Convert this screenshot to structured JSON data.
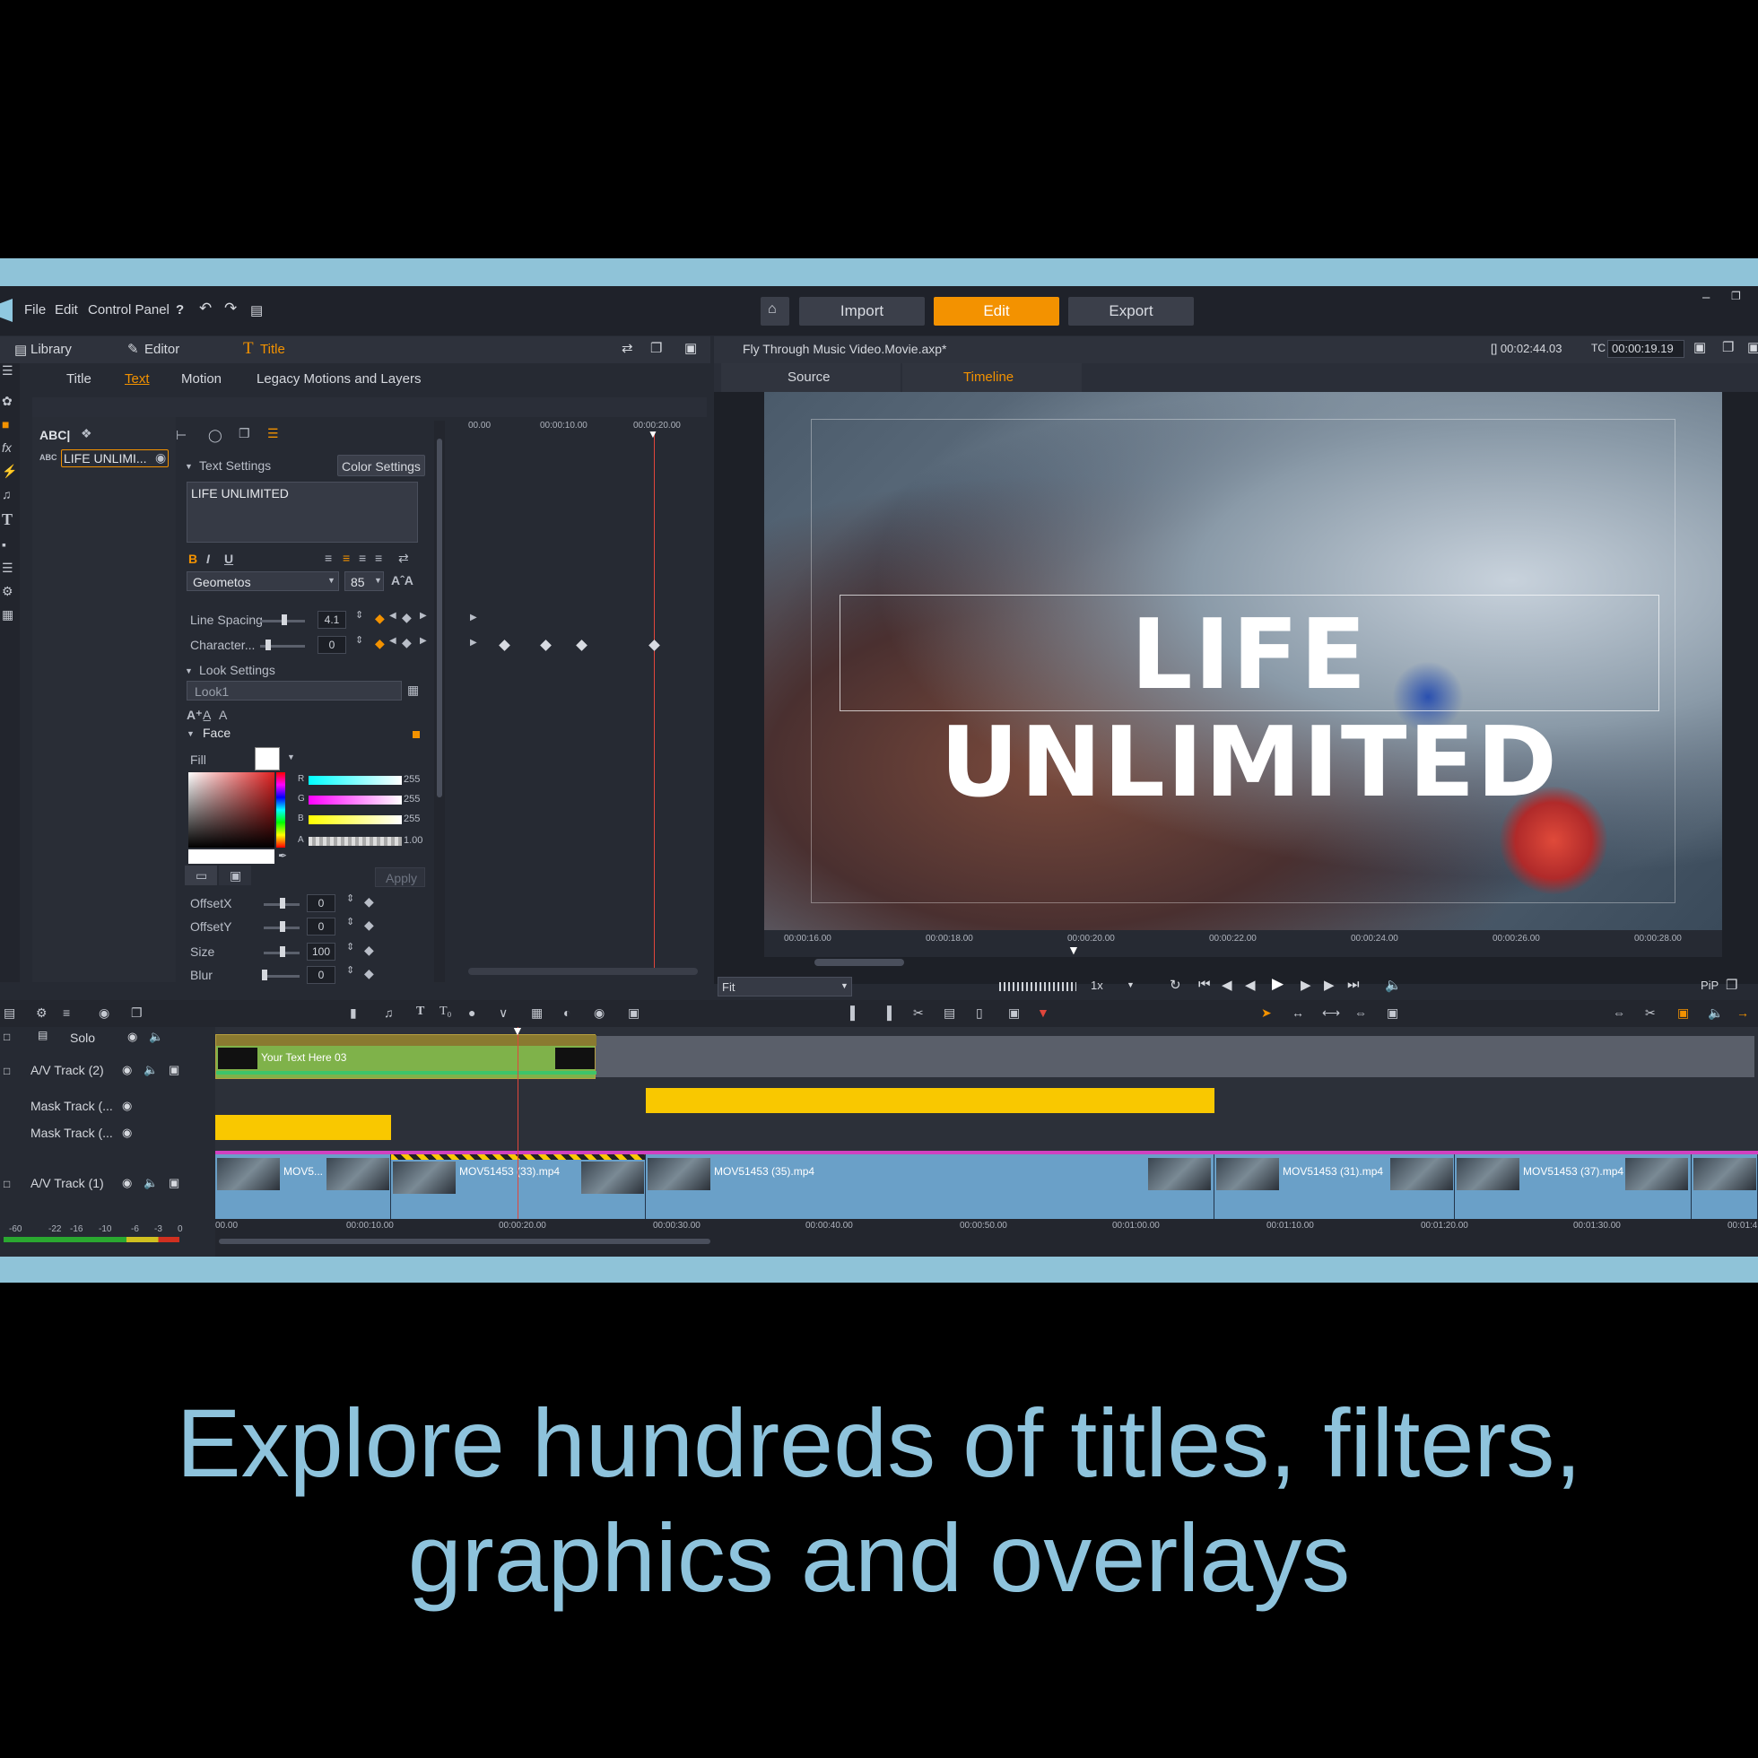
{
  "menu": {
    "file": "File",
    "edit": "Edit",
    "control_panel": "Control Panel",
    "help": "?"
  },
  "modes": {
    "import": "Import",
    "edit": "Edit",
    "export": "Export"
  },
  "left_tabs": {
    "library": "Library",
    "editor": "Editor",
    "title": "Title"
  },
  "sub_tabs": {
    "title": "Title",
    "text": "Text",
    "motion": "Motion",
    "legacy": "Legacy Motions and Layers"
  },
  "layers": {
    "abc_label": "ABC|",
    "layer_name": "LIFE UNLIMI..."
  },
  "text_settings": {
    "header": "Text Settings",
    "color_settings": "Color Settings",
    "text_value": "LIFE UNLIMITED",
    "bold": "B",
    "italic": "I",
    "underline": "U",
    "font": "Geometos",
    "size": "85",
    "line_spacing_label": "Line Spacing",
    "line_spacing_value": "4.1",
    "character_label": "Character...",
    "character_value": "0"
  },
  "look_settings": {
    "header": "Look Settings",
    "look_name": "Look1"
  },
  "face": {
    "header": "Face",
    "fill_label": "Fill",
    "r_label": "R",
    "r": "255",
    "g_label": "G",
    "g": "255",
    "b_label": "B",
    "b": "255",
    "a_label": "A",
    "a": "1.00",
    "apply": "Apply",
    "offsetx_label": "OffsetX",
    "offsetx": "0",
    "offsety_label": "OffsetY",
    "offsety": "0",
    "size_label": "Size",
    "size": "100",
    "blur_label": "Blur",
    "blur": "0"
  },
  "title_timeline": {
    "t0": "00.00",
    "t1": "00:00:10.00",
    "t2": "00:00:20.00"
  },
  "preview": {
    "project_name": "Fly Through Music Video.Movie.axp*",
    "duration": "[] 00:02:44.03",
    "tc_label": "TC",
    "tc": "00:00:19.19",
    "source_tab": "Source",
    "timeline_tab": "Timeline",
    "title_text": "LIFE UNLIMITED",
    "fit": "Fit",
    "speed": "1x",
    "pip": "PiP",
    "ticks": [
      "00:00:16.00",
      "00:00:18.00",
      "00:00:20.00",
      "00:00:22.00",
      "00:00:24.00",
      "00:00:26.00",
      "00:00:28.00"
    ]
  },
  "tracks": {
    "solo": "Solo",
    "av2": "A/V Track (2)",
    "mask1": "Mask Track (...",
    "mask2": "Mask Track (...",
    "av1": "A/V Track (1)",
    "title_clip": "Your Text Here 03",
    "clips": [
      "MOV5...",
      "MOV51453 (33).mp4",
      "MOV51453 (35).mp4",
      "MOV51453 (31).mp4",
      "MOV51453 (37).mp4"
    ]
  },
  "meter_ticks": [
    "-60",
    "-22",
    "-16",
    "-10",
    "-6",
    "-3",
    "0"
  ],
  "timeline_ticks": [
    "00.00",
    "00:00:10.00",
    "00:00:20.00",
    "00:00:30.00",
    "00:00:40.00",
    "00:00:50.00",
    "00:01:00.00",
    "00:01:10.00",
    "00:01:20.00",
    "00:01:30.00",
    "00:01:4"
  ],
  "caption": {
    "line1": "Explore hundreds of titles, filters,",
    "line2": "graphics and overlays"
  },
  "colors": {
    "accent": "#f39200",
    "mask_clip": "#f9c800",
    "av_clip": "#6aa0c8",
    "title_clip": "#7fb24a",
    "caption": "#8ec3dc"
  }
}
